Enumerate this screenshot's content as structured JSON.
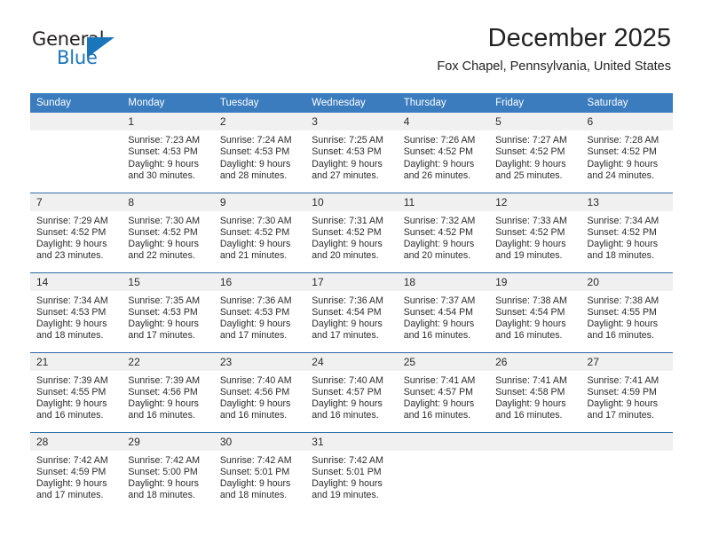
{
  "logo": {
    "word_top": "General",
    "word_bottom": "Blue",
    "accent_color": "#1b75bb",
    "triangle_icon": "triangle-icon"
  },
  "header": {
    "title": "December 2025",
    "subtitle": "Fox Chapel, Pennsylvania, United States"
  },
  "theme": {
    "header_blue": "#3a7cbe",
    "rule_blue": "#2d6ca8",
    "daynum_band": "#f0f0f0",
    "text": "#2b2b2b"
  },
  "calendar": {
    "weekday_headers": [
      "Sunday",
      "Monday",
      "Tuesday",
      "Wednesday",
      "Thursday",
      "Friday",
      "Saturday"
    ],
    "labels": {
      "sunrise": "Sunrise:",
      "sunset": "Sunset:",
      "daylight": "Daylight:"
    },
    "weeks": [
      [
        {
          "day": "",
          "empty": true
        },
        {
          "day": "1",
          "sunrise": "Sunrise: 7:23 AM",
          "sunset": "Sunset: 4:53 PM",
          "daylight_line1": "Daylight: 9 hours",
          "daylight_line2": "and 30 minutes."
        },
        {
          "day": "2",
          "sunrise": "Sunrise: 7:24 AM",
          "sunset": "Sunset: 4:53 PM",
          "daylight_line1": "Daylight: 9 hours",
          "daylight_line2": "and 28 minutes."
        },
        {
          "day": "3",
          "sunrise": "Sunrise: 7:25 AM",
          "sunset": "Sunset: 4:53 PM",
          "daylight_line1": "Daylight: 9 hours",
          "daylight_line2": "and 27 minutes."
        },
        {
          "day": "4",
          "sunrise": "Sunrise: 7:26 AM",
          "sunset": "Sunset: 4:52 PM",
          "daylight_line1": "Daylight: 9 hours",
          "daylight_line2": "and 26 minutes."
        },
        {
          "day": "5",
          "sunrise": "Sunrise: 7:27 AM",
          "sunset": "Sunset: 4:52 PM",
          "daylight_line1": "Daylight: 9 hours",
          "daylight_line2": "and 25 minutes."
        },
        {
          "day": "6",
          "sunrise": "Sunrise: 7:28 AM",
          "sunset": "Sunset: 4:52 PM",
          "daylight_line1": "Daylight: 9 hours",
          "daylight_line2": "and 24 minutes."
        }
      ],
      [
        {
          "day": "7",
          "sunrise": "Sunrise: 7:29 AM",
          "sunset": "Sunset: 4:52 PM",
          "daylight_line1": "Daylight: 9 hours",
          "daylight_line2": "and 23 minutes."
        },
        {
          "day": "8",
          "sunrise": "Sunrise: 7:30 AM",
          "sunset": "Sunset: 4:52 PM",
          "daylight_line1": "Daylight: 9 hours",
          "daylight_line2": "and 22 minutes."
        },
        {
          "day": "9",
          "sunrise": "Sunrise: 7:30 AM",
          "sunset": "Sunset: 4:52 PM",
          "daylight_line1": "Daylight: 9 hours",
          "daylight_line2": "and 21 minutes."
        },
        {
          "day": "10",
          "sunrise": "Sunrise: 7:31 AM",
          "sunset": "Sunset: 4:52 PM",
          "daylight_line1": "Daylight: 9 hours",
          "daylight_line2": "and 20 minutes."
        },
        {
          "day": "11",
          "sunrise": "Sunrise: 7:32 AM",
          "sunset": "Sunset: 4:52 PM",
          "daylight_line1": "Daylight: 9 hours",
          "daylight_line2": "and 20 minutes."
        },
        {
          "day": "12",
          "sunrise": "Sunrise: 7:33 AM",
          "sunset": "Sunset: 4:52 PM",
          "daylight_line1": "Daylight: 9 hours",
          "daylight_line2": "and 19 minutes."
        },
        {
          "day": "13",
          "sunrise": "Sunrise: 7:34 AM",
          "sunset": "Sunset: 4:52 PM",
          "daylight_line1": "Daylight: 9 hours",
          "daylight_line2": "and 18 minutes."
        }
      ],
      [
        {
          "day": "14",
          "sunrise": "Sunrise: 7:34 AM",
          "sunset": "Sunset: 4:53 PM",
          "daylight_line1": "Daylight: 9 hours",
          "daylight_line2": "and 18 minutes."
        },
        {
          "day": "15",
          "sunrise": "Sunrise: 7:35 AM",
          "sunset": "Sunset: 4:53 PM",
          "daylight_line1": "Daylight: 9 hours",
          "daylight_line2": "and 17 minutes."
        },
        {
          "day": "16",
          "sunrise": "Sunrise: 7:36 AM",
          "sunset": "Sunset: 4:53 PM",
          "daylight_line1": "Daylight: 9 hours",
          "daylight_line2": "and 17 minutes."
        },
        {
          "day": "17",
          "sunrise": "Sunrise: 7:36 AM",
          "sunset": "Sunset: 4:54 PM",
          "daylight_line1": "Daylight: 9 hours",
          "daylight_line2": "and 17 minutes."
        },
        {
          "day": "18",
          "sunrise": "Sunrise: 7:37 AM",
          "sunset": "Sunset: 4:54 PM",
          "daylight_line1": "Daylight: 9 hours",
          "daylight_line2": "and 16 minutes."
        },
        {
          "day": "19",
          "sunrise": "Sunrise: 7:38 AM",
          "sunset": "Sunset: 4:54 PM",
          "daylight_line1": "Daylight: 9 hours",
          "daylight_line2": "and 16 minutes."
        },
        {
          "day": "20",
          "sunrise": "Sunrise: 7:38 AM",
          "sunset": "Sunset: 4:55 PM",
          "daylight_line1": "Daylight: 9 hours",
          "daylight_line2": "and 16 minutes."
        }
      ],
      [
        {
          "day": "21",
          "sunrise": "Sunrise: 7:39 AM",
          "sunset": "Sunset: 4:55 PM",
          "daylight_line1": "Daylight: 9 hours",
          "daylight_line2": "and 16 minutes."
        },
        {
          "day": "22",
          "sunrise": "Sunrise: 7:39 AM",
          "sunset": "Sunset: 4:56 PM",
          "daylight_line1": "Daylight: 9 hours",
          "daylight_line2": "and 16 minutes."
        },
        {
          "day": "23",
          "sunrise": "Sunrise: 7:40 AM",
          "sunset": "Sunset: 4:56 PM",
          "daylight_line1": "Daylight: 9 hours",
          "daylight_line2": "and 16 minutes."
        },
        {
          "day": "24",
          "sunrise": "Sunrise: 7:40 AM",
          "sunset": "Sunset: 4:57 PM",
          "daylight_line1": "Daylight: 9 hours",
          "daylight_line2": "and 16 minutes."
        },
        {
          "day": "25",
          "sunrise": "Sunrise: 7:41 AM",
          "sunset": "Sunset: 4:57 PM",
          "daylight_line1": "Daylight: 9 hours",
          "daylight_line2": "and 16 minutes."
        },
        {
          "day": "26",
          "sunrise": "Sunrise: 7:41 AM",
          "sunset": "Sunset: 4:58 PM",
          "daylight_line1": "Daylight: 9 hours",
          "daylight_line2": "and 16 minutes."
        },
        {
          "day": "27",
          "sunrise": "Sunrise: 7:41 AM",
          "sunset": "Sunset: 4:59 PM",
          "daylight_line1": "Daylight: 9 hours",
          "daylight_line2": "and 17 minutes."
        }
      ],
      [
        {
          "day": "28",
          "sunrise": "Sunrise: 7:42 AM",
          "sunset": "Sunset: 4:59 PM",
          "daylight_line1": "Daylight: 9 hours",
          "daylight_line2": "and 17 minutes."
        },
        {
          "day": "29",
          "sunrise": "Sunrise: 7:42 AM",
          "sunset": "Sunset: 5:00 PM",
          "daylight_line1": "Daylight: 9 hours",
          "daylight_line2": "and 18 minutes."
        },
        {
          "day": "30",
          "sunrise": "Sunrise: 7:42 AM",
          "sunset": "Sunset: 5:01 PM",
          "daylight_line1": "Daylight: 9 hours",
          "daylight_line2": "and 18 minutes."
        },
        {
          "day": "31",
          "sunrise": "Sunrise: 7:42 AM",
          "sunset": "Sunset: 5:01 PM",
          "daylight_line1": "Daylight: 9 hours",
          "daylight_line2": "and 19 minutes."
        },
        {
          "day": "",
          "empty": true
        },
        {
          "day": "",
          "empty": true
        },
        {
          "day": "",
          "empty": true
        }
      ]
    ]
  }
}
